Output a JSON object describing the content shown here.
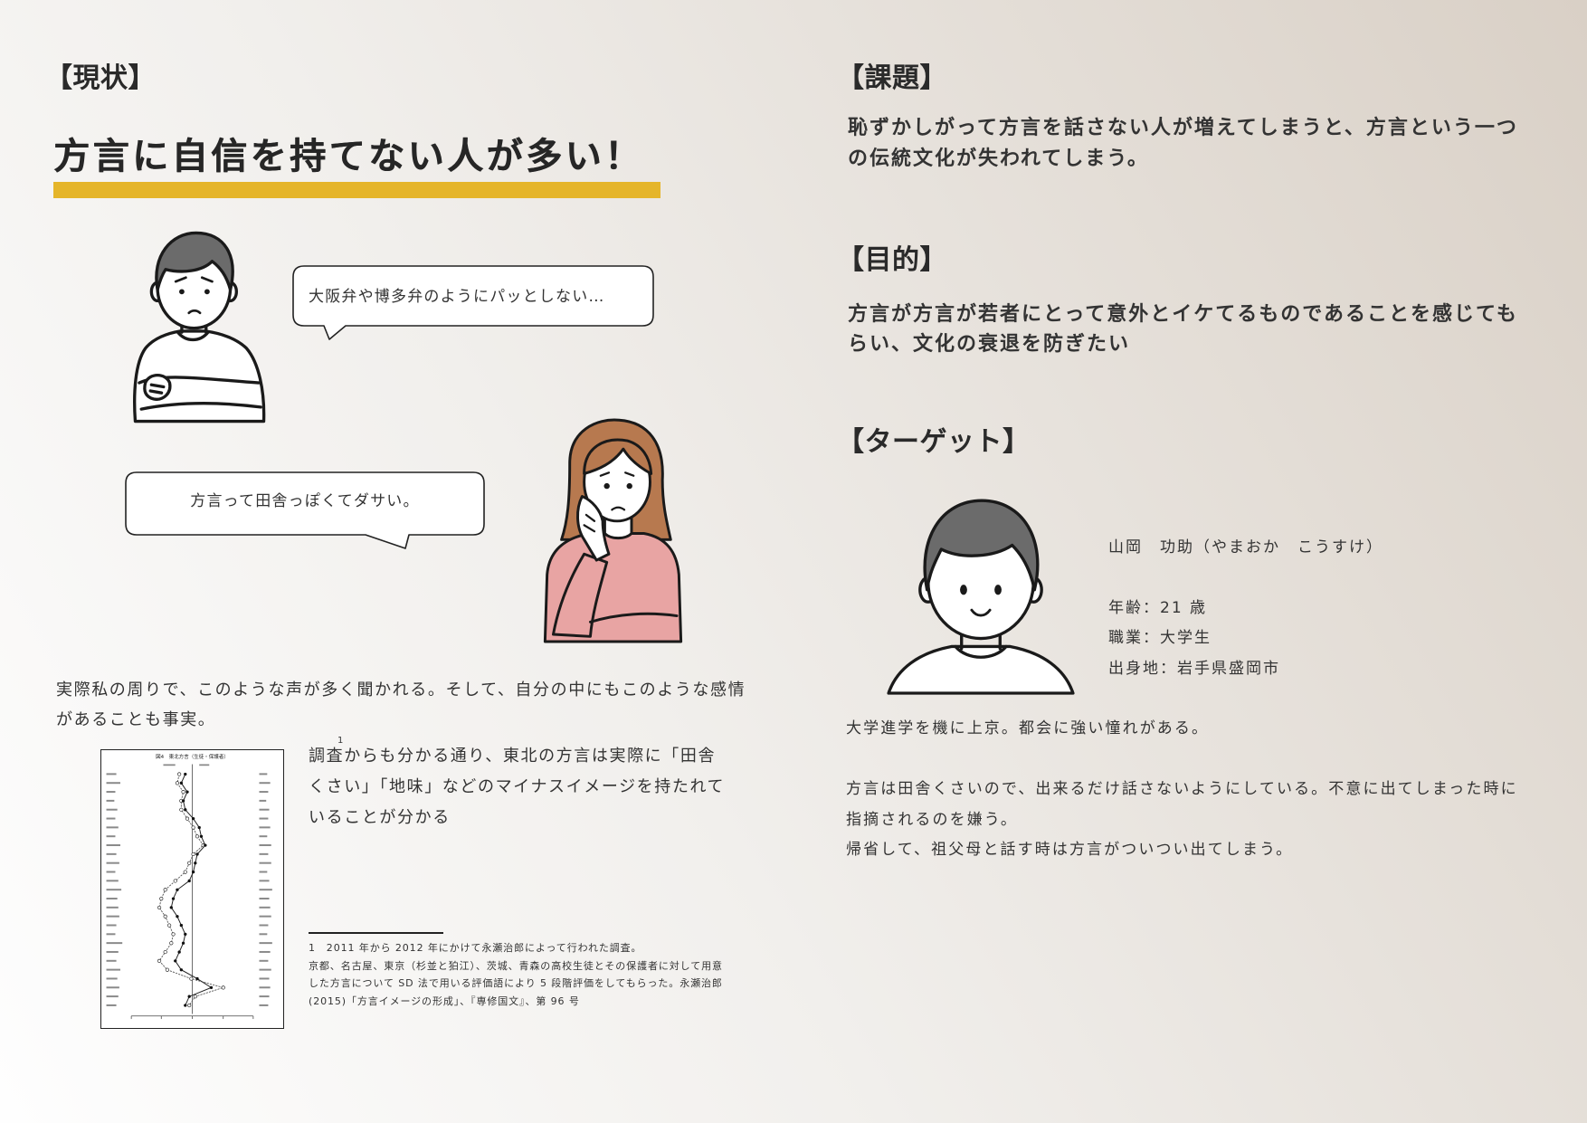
{
  "colors": {
    "background_start": "#fefefe",
    "background_end": "#d9d0c6",
    "accent_bar": "#e5b52a",
    "hair_dark": "#6b6b6b",
    "hair_brown": "#b7794f",
    "shirt_pink": "#e8a4a3"
  },
  "current_state": {
    "heading": "【現状】",
    "title": "方言に自信を持てない人が多い！",
    "bubble_1": "大阪弁や博多弁のようにパッとしない…",
    "bubble_2": "方言って田舎っぽくてダサい。",
    "paragraph": [
      "実際私の周りで、このような声が多く聞かれる。そして、自分の中にもこのような感情",
      "があることも事実。"
    ],
    "survey_text": [
      "調査からも分かる通り、東北の方言は実際に「田舎",
      "くさい」「地味」などのマイナスイメージを持たれて",
      "いることが分かる"
    ],
    "footnote_ref": "1",
    "footnote": [
      "1　2011 年から 2012 年にかけて永瀬治郎によって行われた調査。",
      "京都、名古屋、東京（杉並と狛江）、茨城、青森の高校生徒とその保護者に対して用意",
      "した方言について SD 法で用いる評価語により 5 段階評価をしてもらった。永瀬治郎",
      "(2015)「方言イメージの形成」、『専修国文』、第 96 号"
    ],
    "figure": {
      "title": "図4　東北方言（生徒・保護者）"
    }
  },
  "issue": {
    "heading": "【課題】",
    "lines": [
      "恥ずかしがって方言を話さない人が増えてしまうと、方言という一つ",
      "の伝統文化が失われてしまう。"
    ]
  },
  "purpose": {
    "heading": "【目的】",
    "lines": [
      "方言が方言が若者にとって意外とイケてるものであることを感じても",
      "らい、文化の衰退を防ぎたい"
    ]
  },
  "target": {
    "heading": "【ターゲット】",
    "profile": {
      "name": "山岡　功助（やまおか　こうすけ）",
      "age": "年齢：21 歳",
      "occupation": "職業：大学生",
      "hometown": "出身地：岩手県盛岡市"
    },
    "description": [
      "大学進学を機に上京。都会に強い憧れがある。",
      "方言は田舎くさいので、出来るだけ話さないようにしている。不意に出てしまった時に",
      "指摘されるのを嫌う。",
      "帰省して、祖父母と話す時は方言がついつい出てしまう。"
    ]
  }
}
